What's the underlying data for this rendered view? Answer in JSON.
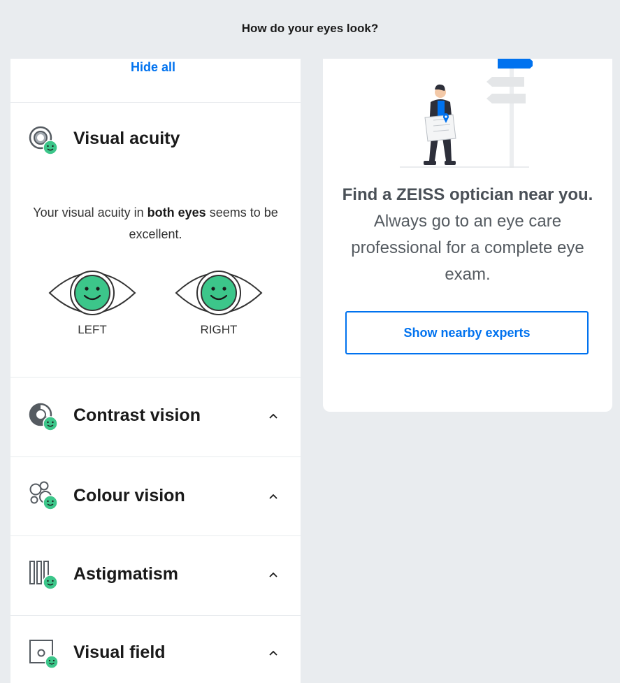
{
  "header": {
    "title": "How do your eyes look?"
  },
  "results": {
    "hide_all": "Hide all",
    "visual_acuity": {
      "title": "Visual acuity",
      "text_pre": "Your visual acuity in ",
      "text_bold": "both eyes",
      "text_post": " seems to be excellent.",
      "left_label": "LEFT",
      "right_label": "RIGHT"
    },
    "contrast": {
      "title": "Contrast vision"
    },
    "colour": {
      "title": "Colour vision"
    },
    "astigmatism": {
      "title": "Astigmatism"
    },
    "visual_field": {
      "title": "Visual field"
    }
  },
  "optician_card": {
    "bold_text": "Find a ZEISS optician near you.",
    "text": " Always go to an eye care professional for a complete eye exam.",
    "button": "Show nearby experts"
  },
  "colors": {
    "accent": "#0072ef",
    "smiley": "#3cc68a",
    "background": "#e9ecef"
  }
}
